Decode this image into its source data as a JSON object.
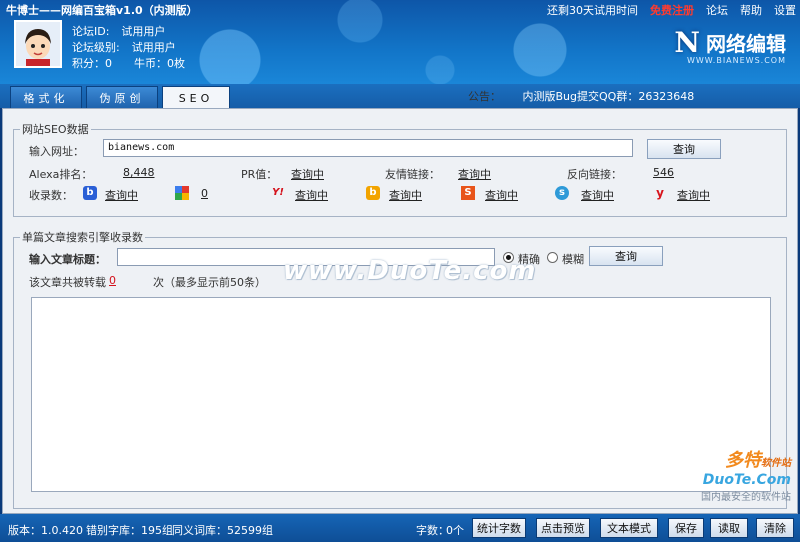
{
  "app": {
    "title": "牛博士——网编百宝箱v1.0（内测版）"
  },
  "topnav": {
    "trial": "还剩30天试用时间",
    "register": "免费注册",
    "forum": "论坛",
    "help": "帮助",
    "settings": "设置"
  },
  "user": {
    "id_label": "论坛ID:",
    "id_value": "试用用户",
    "level_label": "论坛级别:",
    "level_value": "试用用户",
    "points_label": "积分：0",
    "coins_label": "牛币：0枚"
  },
  "logo": {
    "mark": "N",
    "text": "网络编辑",
    "url": "WWW.BIANEWS.COM"
  },
  "tabs": [
    {
      "label": "格式化"
    },
    {
      "label": "伪原创"
    },
    {
      "label": "SEO"
    }
  ],
  "notice": {
    "label": "公告：",
    "text": "内测版Bug提交QQ群：26323648"
  },
  "seo": {
    "legend": "网站SEO数据",
    "url_label": "输入网址：",
    "url_value": "bianews.com",
    "query_button": "查询",
    "alexa_label": "Alexa排名：",
    "alexa_value": "8,448",
    "pr_label": "PR值：",
    "pr_value": "查询中",
    "friend_label": "友情链接：",
    "friend_value": "查询中",
    "backlink_label": "反向链接：",
    "backlink_value": "546",
    "indexed_label": "收录数：",
    "engines": [
      {
        "icon": "baidu-icon",
        "value": "查询中",
        "color": "#2a5fd6"
      },
      {
        "icon": "google-icon",
        "value": "0",
        "color": "#3b7ded"
      },
      {
        "icon": "yahoo-icon",
        "value": "查询中",
        "color": "#d4121c"
      },
      {
        "icon": "bing-icon",
        "value": "查询中",
        "color": "#f2a400"
      },
      {
        "icon": "sogou-icon",
        "value": "查询中",
        "color": "#e8541a"
      },
      {
        "icon": "soso-icon",
        "value": "查询中",
        "color": "#2e9ad8"
      },
      {
        "icon": "youdao-icon",
        "value": "查询中",
        "color": "#d8141c"
      }
    ]
  },
  "article": {
    "legend": "单篇文章搜索引擎收录数",
    "title_label": "输入文章标题：",
    "title_value": "",
    "exact_label": "精确",
    "fuzzy_label": "模糊",
    "query_button": "查询",
    "repost_label": "该文章共被转载",
    "repost_count": "0",
    "repost_suffix": "次（最多显示前50条）"
  },
  "watermark": {
    "text": "www.DuoTe.com",
    "brand": "多特",
    "brand_sub": "软件站",
    "domain": "DuoTe.Com",
    "slogan": "国内最安全的软件站"
  },
  "status": {
    "version": "版本：1.0.420",
    "errors": "错别字库：195组",
    "synonyms": "同义词库：52599组",
    "chars_label": "字数：",
    "chars_value": "0个",
    "btn_count": "统计字数",
    "btn_preview": "点击预览",
    "btn_text_mode": "文本模式",
    "btn_save": "保存",
    "btn_read": "读取",
    "btn_clear": "清除"
  }
}
